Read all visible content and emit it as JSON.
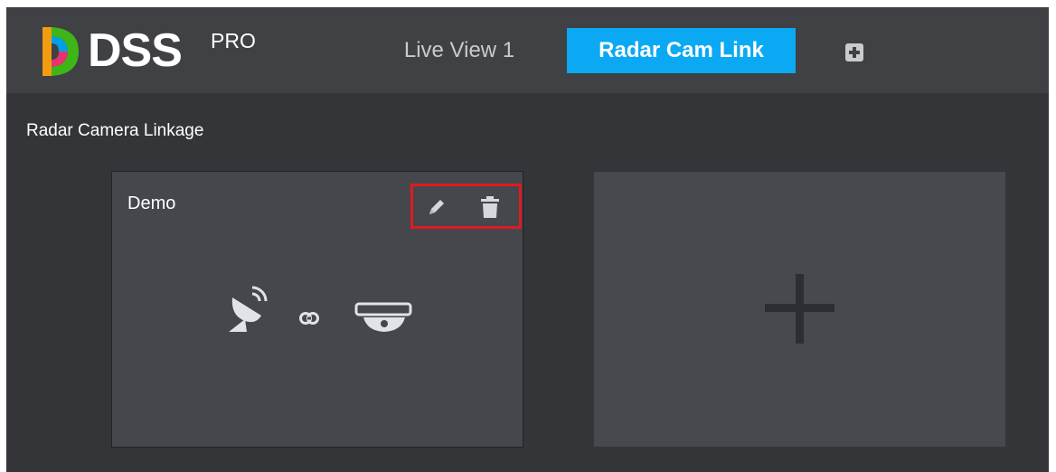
{
  "header": {
    "logo_text": "DSS",
    "logo_suffix": "PRO",
    "tabs": [
      {
        "label": "Live View 1",
        "active": false
      },
      {
        "label": "Radar Cam Link",
        "active": true
      }
    ],
    "add_tab_icon": "plus-square-icon"
  },
  "main": {
    "section_title": "Radar Camera Linkage",
    "cards": [
      {
        "name": "Demo",
        "actions": [
          "edit-icon",
          "delete-icon"
        ],
        "icons": [
          "radar-dish-icon",
          "link-icon",
          "dome-camera-icon"
        ]
      }
    ],
    "add_card_icon": "plus-icon"
  },
  "colors": {
    "active_tab": "#0ba9f3",
    "highlight_border": "#e01a22",
    "background": "#333539",
    "header": "#3f4145",
    "card": "#45474c"
  }
}
